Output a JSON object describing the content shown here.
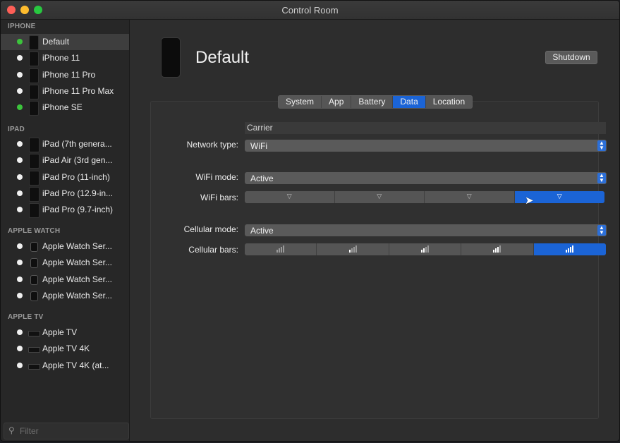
{
  "window": {
    "title": "Control Room"
  },
  "sidebar": {
    "sections": [
      {
        "header": "IPHONE",
        "items": [
          {
            "label": "Default",
            "status": "booted",
            "selected": true
          },
          {
            "label": "iPhone 11",
            "status": "off"
          },
          {
            "label": "iPhone 11 Pro",
            "status": "off"
          },
          {
            "label": "iPhone 11 Pro Max",
            "status": "off"
          },
          {
            "label": "iPhone SE",
            "status": "booted"
          }
        ]
      },
      {
        "header": "IPAD",
        "items": [
          {
            "label": "iPad (7th genera...",
            "status": "off"
          },
          {
            "label": "iPad Air (3rd gen...",
            "status": "off"
          },
          {
            "label": "iPad Pro (11-inch)",
            "status": "off"
          },
          {
            "label": "iPad Pro (12.9-in...",
            "status": "off"
          },
          {
            "label": "iPad Pro (9.7-inch)",
            "status": "off"
          }
        ]
      },
      {
        "header": "APPLE WATCH",
        "items": [
          {
            "label": "Apple Watch Ser...",
            "status": "off"
          },
          {
            "label": "Apple Watch Ser...",
            "status": "off"
          },
          {
            "label": "Apple Watch Ser...",
            "status": "off"
          },
          {
            "label": "Apple Watch Ser...",
            "status": "off"
          }
        ]
      },
      {
        "header": "APPLE TV",
        "items": [
          {
            "label": "Apple TV",
            "status": "off"
          },
          {
            "label": "Apple TV 4K",
            "status": "off"
          },
          {
            "label": "Apple TV 4K (at...",
            "status": "off"
          }
        ]
      }
    ],
    "filter": {
      "placeholder": "Filter",
      "icon": "search-icon"
    }
  },
  "main": {
    "device_title": "Default",
    "shutdown_label": "Shutdown",
    "tabs": [
      "System",
      "App",
      "Battery",
      "Data",
      "Location"
    ],
    "active_tab": "Data",
    "carrier": {
      "value": "Carrier"
    },
    "network_type": {
      "label": "Network type:",
      "value": "WiFi"
    },
    "wifi_mode": {
      "label": "WiFi mode:",
      "value": "Active"
    },
    "wifi_bars": {
      "label": "WiFi bars:",
      "options": 4,
      "selected": 4,
      "icon": "wifi-icon"
    },
    "cellular_mode": {
      "label": "Cellular mode:",
      "value": "Active"
    },
    "cellular_bars": {
      "label": "Cellular bars:",
      "options": 5,
      "selected": 5,
      "icon": "cellular-bars-icon"
    }
  },
  "colors": {
    "accent": "#1b64d6",
    "booted": "#3cc43c"
  }
}
